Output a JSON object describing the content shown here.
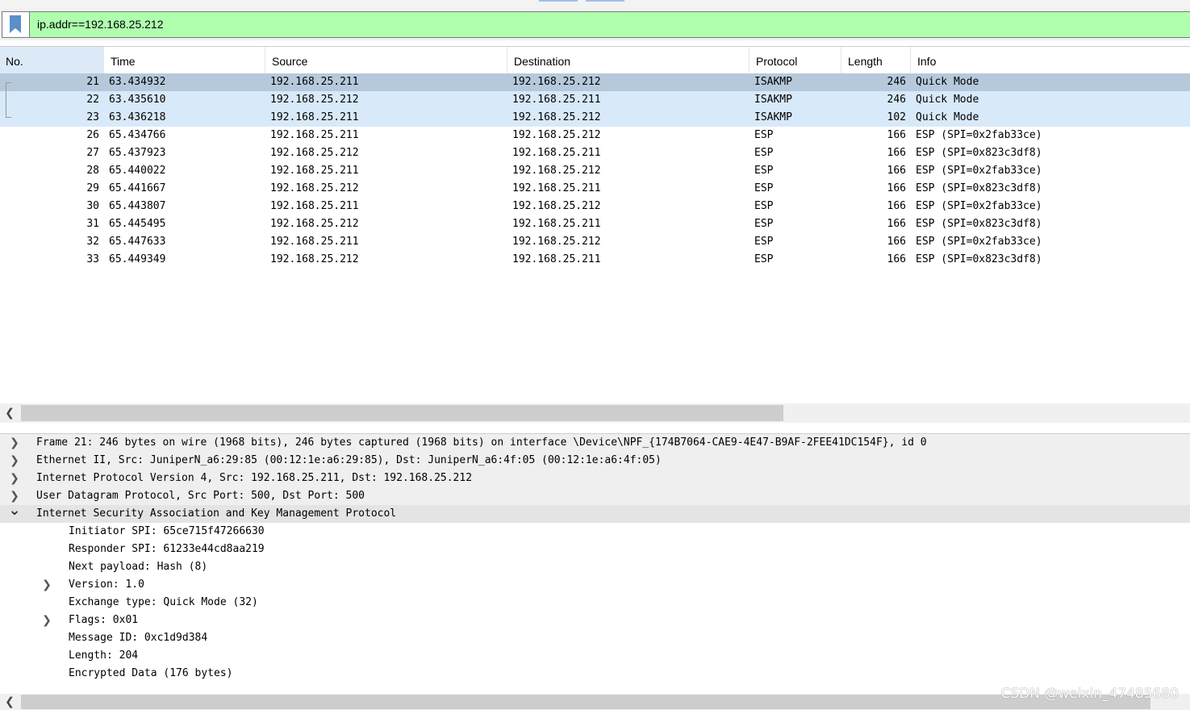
{
  "filter": {
    "expression": "ip.addr==192.168.25.212"
  },
  "columns": [
    "No.",
    "Time",
    "Source",
    "Destination",
    "Protocol",
    "Length",
    "Info"
  ],
  "packets": [
    {
      "no": "21",
      "time": "63.434932",
      "src": "192.168.25.211",
      "dst": "192.168.25.212",
      "proto": "ISAKMP",
      "len": "246",
      "info": "Quick Mode",
      "state": "sel"
    },
    {
      "no": "22",
      "time": "63.435610",
      "src": "192.168.25.212",
      "dst": "192.168.25.211",
      "proto": "ISAKMP",
      "len": "246",
      "info": "Quick Mode",
      "state": "rel"
    },
    {
      "no": "23",
      "time": "63.436218",
      "src": "192.168.25.211",
      "dst": "192.168.25.212",
      "proto": "ISAKMP",
      "len": "102",
      "info": "Quick Mode",
      "state": "rel"
    },
    {
      "no": "26",
      "time": "65.434766",
      "src": "192.168.25.211",
      "dst": "192.168.25.212",
      "proto": "ESP",
      "len": "166",
      "info": "ESP (SPI=0x2fab33ce)",
      "state": ""
    },
    {
      "no": "27",
      "time": "65.437923",
      "src": "192.168.25.212",
      "dst": "192.168.25.211",
      "proto": "ESP",
      "len": "166",
      "info": "ESP (SPI=0x823c3df8)",
      "state": ""
    },
    {
      "no": "28",
      "time": "65.440022",
      "src": "192.168.25.211",
      "dst": "192.168.25.212",
      "proto": "ESP",
      "len": "166",
      "info": "ESP (SPI=0x2fab33ce)",
      "state": ""
    },
    {
      "no": "29",
      "time": "65.441667",
      "src": "192.168.25.212",
      "dst": "192.168.25.211",
      "proto": "ESP",
      "len": "166",
      "info": "ESP (SPI=0x823c3df8)",
      "state": ""
    },
    {
      "no": "30",
      "time": "65.443807",
      "src": "192.168.25.211",
      "dst": "192.168.25.212",
      "proto": "ESP",
      "len": "166",
      "info": "ESP (SPI=0x2fab33ce)",
      "state": ""
    },
    {
      "no": "31",
      "time": "65.445495",
      "src": "192.168.25.212",
      "dst": "192.168.25.211",
      "proto": "ESP",
      "len": "166",
      "info": "ESP (SPI=0x823c3df8)",
      "state": ""
    },
    {
      "no": "32",
      "time": "65.447633",
      "src": "192.168.25.211",
      "dst": "192.168.25.212",
      "proto": "ESP",
      "len": "166",
      "info": "ESP (SPI=0x2fab33ce)",
      "state": ""
    },
    {
      "no": "33",
      "time": "65.449349",
      "src": "192.168.25.212",
      "dst": "192.168.25.211",
      "proto": "ESP",
      "len": "166",
      "info": "ESP (SPI=0x823c3df8)",
      "state": ""
    }
  ],
  "details": [
    {
      "text": "Frame 21: 246 bytes on wire (1968 bits), 246 bytes captured (1968 bits) on interface \\Device\\NPF_{174B7064-CAE9-4E47-B9AF-2FEE41DC154F}, id 0",
      "level": 0,
      "expander": "collapsed"
    },
    {
      "text": "Ethernet II, Src: JuniperN_a6:29:85 (00:12:1e:a6:29:85), Dst: JuniperN_a6:4f:05 (00:12:1e:a6:4f:05)",
      "level": 0,
      "expander": "collapsed"
    },
    {
      "text": "Internet Protocol Version 4, Src: 192.168.25.211, Dst: 192.168.25.212",
      "level": 0,
      "expander": "collapsed"
    },
    {
      "text": "User Datagram Protocol, Src Port: 500, Dst Port: 500",
      "level": 0,
      "expander": "collapsed"
    },
    {
      "text": "Internet Security Association and Key Management Protocol",
      "level": 0,
      "expander": "expanded"
    },
    {
      "text": "Initiator SPI: 65ce715f47266630",
      "level": 1,
      "expander": "none"
    },
    {
      "text": "Responder SPI: 61233e44cd8aa219",
      "level": 1,
      "expander": "none"
    },
    {
      "text": "Next payload: Hash (8)",
      "level": 1,
      "expander": "none"
    },
    {
      "text": "Version: 1.0",
      "level": 1,
      "expander": "collapsed"
    },
    {
      "text": "Exchange type: Quick Mode (32)",
      "level": 1,
      "expander": "none"
    },
    {
      "text": "Flags: 0x01",
      "level": 1,
      "expander": "collapsed"
    },
    {
      "text": "Message ID: 0xc1d9d384",
      "level": 1,
      "expander": "none"
    },
    {
      "text": "Length: 204",
      "level": 1,
      "expander": "none"
    },
    {
      "text": "Encrypted Data (176 bytes)",
      "level": 1,
      "expander": "none"
    }
  ],
  "icons": {
    "bookmark": "bookmark-icon",
    "collapsed": "chevron-right-icon",
    "expanded": "chevron-down-icon",
    "scroll_left": "chevron-left-icon"
  },
  "colors": {
    "filter_valid": "#afffaf",
    "selected_row": "#b6c9dc",
    "related_row": "#d8e9fa",
    "sorted_header": "#dce9f7"
  },
  "watermark": "CSDN @weixin_47485680"
}
